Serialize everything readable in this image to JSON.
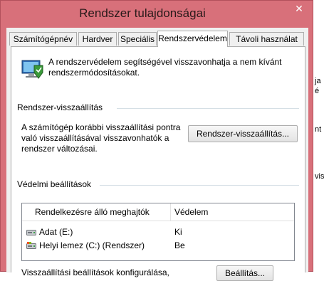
{
  "window": {
    "title": "Rendszer tulajdonságai",
    "close_glyph": "✕"
  },
  "tabs": [
    {
      "label": "Számítógépnév",
      "active": false
    },
    {
      "label": "Hardver",
      "active": false
    },
    {
      "label": "Speciális",
      "active": false
    },
    {
      "label": "Rendszervédelem",
      "active": true
    },
    {
      "label": "Távoli használat",
      "active": false
    }
  ],
  "intro": {
    "icon": "system-protection-icon",
    "text_line1": "A rendszervédelem segítségével visszavonhatja a nem kívánt",
    "text_line2": "rendszermódosításokat."
  },
  "restore": {
    "heading": "Rendszer-visszaállítás",
    "desc_line1": "A számítógép korábbi visszaállítási pontra",
    "desc_line2": "való visszaállításával visszavonhatók a",
    "desc_line3": "rendszer változásai.",
    "button_label": "Rendszer-visszaállítás..."
  },
  "protection": {
    "heading": "Védelmi beállítások",
    "columns": [
      "Rendelkezésre álló meghajtók",
      "Védelem"
    ],
    "rows": [
      {
        "name": "Adat (E:)",
        "state": "Ki",
        "icon": "drive-icon"
      },
      {
        "name": "Helyi lemez (C:) (Rendszer)",
        "state": "Be",
        "icon": "system-drive-icon"
      }
    ],
    "config_text": "Visszaállítási beállítások konfigurálása,",
    "config_button_label": "Beállítás..."
  },
  "background_edge": {
    "fragments": [
      "ja",
      "é",
      "nt",
      "vis"
    ]
  },
  "colors": {
    "titlebar": "#d8707a",
    "panel": "#ffffff",
    "client": "#f0f0f0"
  }
}
